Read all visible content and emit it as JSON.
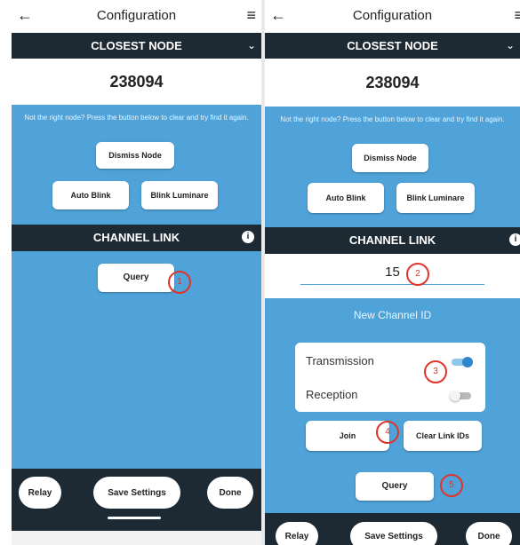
{
  "app": {
    "title": "Configuration"
  },
  "closest_node": {
    "header": "CLOSEST NODE",
    "value": "238094"
  },
  "hint": "Not the right node? Press the button below to clear and try find it again.",
  "buttons": {
    "dismiss_node": "Dismiss Node",
    "auto_blink": "Auto Blink",
    "blink_luminaire": "Blink Luminare",
    "query": "Query",
    "join": "Join",
    "clear_link_ids": "Clear Link IDs",
    "relay": "Relay",
    "save_settings": "Save Settings",
    "done": "Done"
  },
  "channel_link": {
    "header": "CHANNEL LINK",
    "channel_value": "15",
    "new_channel_label": "New Channel ID",
    "transmission_label": "Transmission",
    "transmission_on": true,
    "reception_label": "Reception",
    "reception_on": false
  },
  "markers": {
    "m1": "1",
    "m2": "2",
    "m3": "3",
    "m4": "4",
    "m5": "5"
  },
  "colors": {
    "accent": "#4fa3d9",
    "dark": "#1e2a33",
    "marker": "#e0342a"
  },
  "icons": {
    "back": "arrow-left-icon",
    "menu": "hamburger-menu-icon",
    "info": "info-icon",
    "chevron": "chevron-down-icon"
  }
}
